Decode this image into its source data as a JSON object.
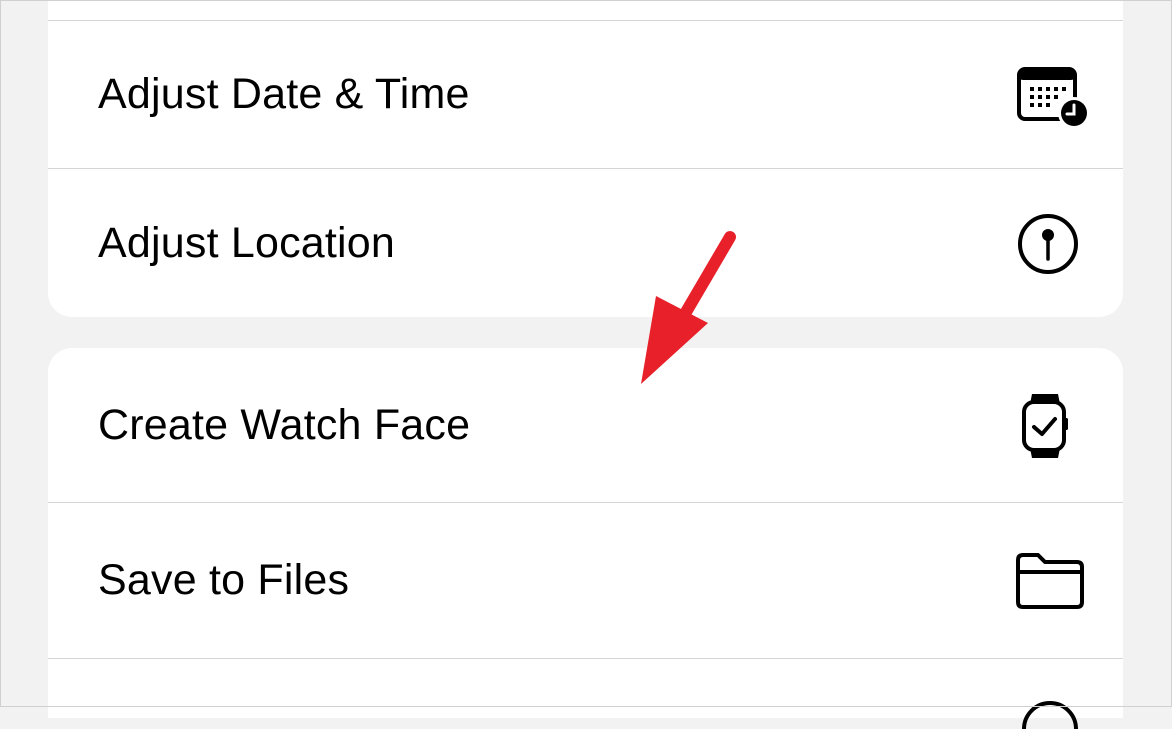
{
  "menu": {
    "group_1": [
      {
        "label": "Adjust Date & Time",
        "icon": "calendar-clock-icon"
      },
      {
        "label": "Adjust Location",
        "icon": "location-pin-icon"
      }
    ],
    "group_2": [
      {
        "label": "Create Watch Face",
        "icon": "watch-icon"
      },
      {
        "label": "Save to Files",
        "icon": "folder-icon"
      }
    ]
  },
  "annotation": {
    "arrow_color": "#e8202a",
    "points_to": "Create Watch Face"
  },
  "colors": {
    "background": "#f2f2f2",
    "card": "#ffffff",
    "separator": "#d5d5d5"
  }
}
